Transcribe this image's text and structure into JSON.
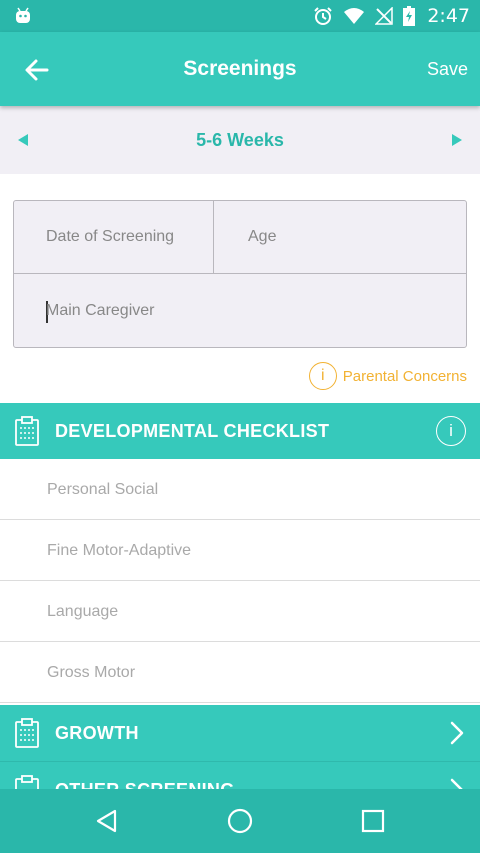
{
  "status_bar": {
    "time": "2:47",
    "icons": [
      "android-icon",
      "alarm-icon",
      "wifi-icon",
      "signal-off-icon",
      "battery-charging-icon"
    ]
  },
  "app_bar": {
    "title": "Screenings",
    "save_label": "Save",
    "back_icon": "arrow-left-icon"
  },
  "week_selector": {
    "label": "5-6 Weeks"
  },
  "form": {
    "date_placeholder": "Date of Screening",
    "age_placeholder": "Age",
    "caregiver_placeholder": "Main Caregiver"
  },
  "parental_concerns": {
    "label": "Parental Concerns"
  },
  "sections": {
    "developmental": {
      "title": "DEVELOPMENTAL CHECKLIST",
      "items": [
        "Personal Social",
        "Fine Motor-Adaptive",
        "Language",
        "Gross Motor"
      ]
    },
    "growth": {
      "title": "GROWTH"
    },
    "other": {
      "title": "OTHER SCREENING"
    }
  },
  "colors": {
    "status_bar": "#2ab7aa",
    "accent": "#36c9bb",
    "warning": "#f2b233",
    "panel": "#f1eff5"
  }
}
